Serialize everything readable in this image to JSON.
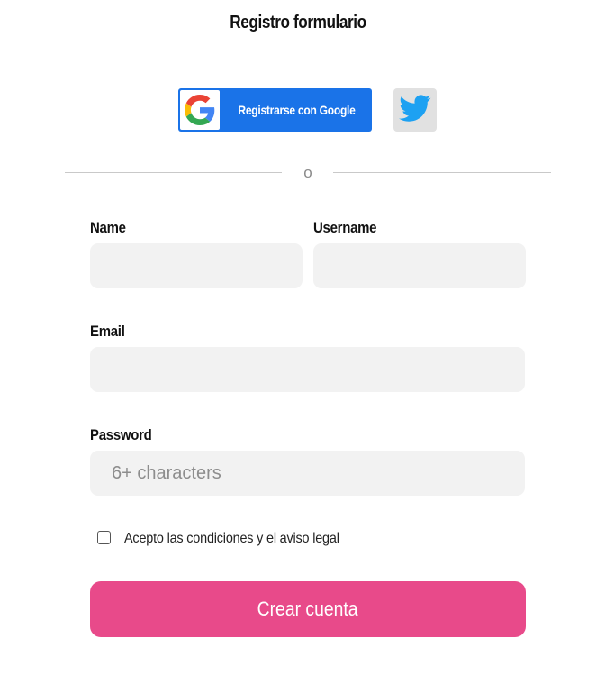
{
  "form": {
    "title": "Registro formulario",
    "social": {
      "google_label": "Registrarse con Google",
      "google_icon": "google-g-logo-icon",
      "twitter_icon": "twitter-bird-icon"
    },
    "divider_text": "o",
    "fields": {
      "name": {
        "label": "Name",
        "value": "",
        "placeholder": ""
      },
      "username": {
        "label": "Username",
        "value": "",
        "placeholder": ""
      },
      "email": {
        "label": "Email",
        "value": "",
        "placeholder": ""
      },
      "password": {
        "label": "Password",
        "value": "",
        "placeholder": "6+ characters"
      }
    },
    "terms": {
      "label": "Acepto las condiciones y el aviso legal",
      "checked": false
    },
    "submit_label": "Crear cuenta",
    "colors": {
      "google_blue": "#1a73e8",
      "twitter_blue": "#1da1f2",
      "submit_pink": "#e84a8a",
      "field_bg": "#f2f2f2"
    }
  }
}
